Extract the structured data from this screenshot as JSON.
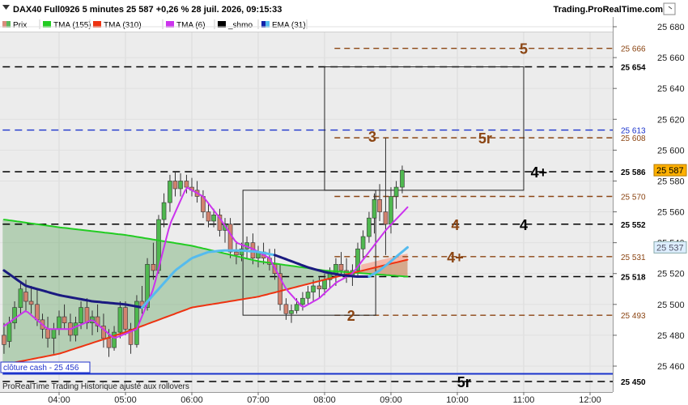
{
  "header": {
    "title": "DAX40 Full0926 5 minutes 25 587 +0,26 % 28 juil. 2026, 09:15:33",
    "site": "Trading.ProRealTime.com"
  },
  "legend": [
    {
      "label": "Prix",
      "color": "#d98c7a",
      "color2": "#5bb85b"
    },
    {
      "label": "TMA (155)",
      "color": "#22cc22"
    },
    {
      "label": "TMA (310)",
      "color": "#ee3311"
    },
    {
      "label": "TMA (6)",
      "color": "#cc33ee"
    },
    {
      "label": "_shmo",
      "color": "#000000"
    },
    {
      "label": "EMA (31)",
      "color": "#1122aa",
      "color2": "#55bbee"
    }
  ],
  "footer": {
    "cloture_label": "clôture cash -  25 456",
    "note": "ProRealTime Trading  Historique ajusté aux rollovers"
  },
  "chart_data": {
    "type": "candlestick",
    "ylim": [
      25445,
      25680
    ],
    "y_ticks": [
      "25 460",
      "25 480",
      "25 500",
      "25 520",
      "25 540",
      "25 560",
      "25 580",
      "25 600",
      "25 620",
      "25 640",
      "25 660",
      "25 680"
    ],
    "x_ticks": [
      "04:00",
      "05:00",
      "06:00",
      "07:00",
      "08:00",
      "09:00",
      "10:00",
      "11:00",
      "12:00"
    ],
    "x_tick_hours": [
      4,
      5,
      6,
      7,
      8,
      9,
      10,
      11,
      12
    ],
    "x_range_hours": [
      3.15,
      12.5
    ],
    "last_price": {
      "label": "25 587",
      "value": 25587
    },
    "ema_price": {
      "label": "25 537",
      "value": 25537
    },
    "candles": [
      [
        3.17,
        25480,
        25488,
        25468,
        25474
      ],
      [
        3.25,
        25476,
        25492,
        25472,
        25488
      ],
      [
        3.33,
        25488,
        25502,
        25484,
        25498
      ],
      [
        3.42,
        25498,
        25514,
        25494,
        25510
      ],
      [
        3.5,
        25508,
        25516,
        25496,
        25502
      ],
      [
        3.58,
        25502,
        25512,
        25494,
        25500
      ],
      [
        3.67,
        25500,
        25510,
        25486,
        25490
      ],
      [
        3.75,
        25490,
        25494,
        25478,
        25484
      ],
      [
        3.83,
        25484,
        25492,
        25472,
        25478
      ],
      [
        3.92,
        25478,
        25488,
        25468,
        25484
      ],
      [
        4.0,
        25484,
        25496,
        25480,
        25492
      ],
      [
        4.08,
        25492,
        25500,
        25484,
        25488
      ],
      [
        4.17,
        25488,
        25494,
        25476,
        25480
      ],
      [
        4.25,
        25480,
        25492,
        25476,
        25488
      ],
      [
        4.33,
        25488,
        25502,
        25484,
        25498
      ],
      [
        4.42,
        25498,
        25504,
        25484,
        25488
      ],
      [
        4.5,
        25488,
        25496,
        25480,
        25492
      ],
      [
        4.58,
        25492,
        25500,
        25482,
        25486
      ],
      [
        4.67,
        25486,
        25494,
        25472,
        25478
      ],
      [
        4.75,
        25478,
        25484,
        25466,
        25472
      ],
      [
        4.83,
        25472,
        25486,
        25470,
        25482
      ],
      [
        4.92,
        25482,
        25502,
        25478,
        25498
      ],
      [
        5.0,
        25498,
        25502,
        25480,
        25484
      ],
      [
        5.08,
        25484,
        25488,
        25468,
        25474
      ],
      [
        5.17,
        25474,
        25506,
        25472,
        25502
      ],
      [
        5.25,
        25502,
        25512,
        25494,
        25498
      ],
      [
        5.33,
        25498,
        25530,
        25496,
        25526
      ],
      [
        5.42,
        25526,
        25540,
        25516,
        25522
      ],
      [
        5.5,
        25522,
        25558,
        25520,
        25555
      ],
      [
        5.58,
        25555,
        25572,
        25550,
        25566
      ],
      [
        5.67,
        25566,
        25584,
        25560,
        25580
      ],
      [
        5.75,
        25580,
        25586,
        25570,
        25575
      ],
      [
        5.83,
        25575,
        25585,
        25570,
        25580
      ],
      [
        5.92,
        25580,
        25584,
        25572,
        25576
      ],
      [
        6.0,
        25576,
        25582,
        25570,
        25574
      ],
      [
        6.08,
        25574,
        25580,
        25566,
        25570
      ],
      [
        6.17,
        25570,
        25574,
        25556,
        25560
      ],
      [
        6.25,
        25560,
        25566,
        25550,
        25554
      ],
      [
        6.33,
        25554,
        25562,
        25550,
        25558
      ],
      [
        6.42,
        25558,
        25562,
        25544,
        25548
      ],
      [
        6.5,
        25548,
        25556,
        25540,
        25552
      ],
      [
        6.58,
        25552,
        25556,
        25530,
        25534
      ],
      [
        6.67,
        25534,
        25540,
        25526,
        25532
      ],
      [
        6.75,
        25532,
        25540,
        25528,
        25536
      ],
      [
        6.83,
        25536,
        25544,
        25530,
        25540
      ],
      [
        6.92,
        25540,
        25546,
        25526,
        25530
      ],
      [
        7.0,
        25530,
        25538,
        25524,
        25534
      ],
      [
        7.08,
        25534,
        25540,
        25526,
        25530
      ],
      [
        7.17,
        25530,
        25536,
        25522,
        25526
      ],
      [
        7.25,
        25526,
        25536,
        25516,
        25520
      ],
      [
        7.33,
        25520,
        25526,
        25496,
        25500
      ],
      [
        7.42,
        25500,
        25504,
        25490,
        25494
      ],
      [
        7.5,
        25494,
        25500,
        25488,
        25496
      ],
      [
        7.58,
        25496,
        25504,
        25494,
        25500
      ],
      [
        7.67,
        25500,
        25508,
        25496,
        25504
      ],
      [
        7.75,
        25504,
        25512,
        25500,
        25508
      ],
      [
        7.83,
        25508,
        25516,
        25502,
        25512
      ],
      [
        7.92,
        25512,
        25518,
        25504,
        25510
      ],
      [
        8.0,
        25510,
        25520,
        25506,
        25516
      ],
      [
        8.08,
        25516,
        25524,
        25510,
        25520
      ],
      [
        8.17,
        25520,
        25530,
        25512,
        25526
      ],
      [
        8.25,
        25526,
        25534,
        25518,
        25522
      ],
      [
        8.33,
        25522,
        25530,
        25514,
        25518
      ],
      [
        8.42,
        25518,
        25526,
        25512,
        25522
      ],
      [
        8.5,
        25522,
        25540,
        25518,
        25536
      ],
      [
        8.58,
        25536,
        25548,
        25530,
        25544
      ],
      [
        8.67,
        25544,
        25560,
        25540,
        25556
      ],
      [
        8.75,
        25556,
        25572,
        25546,
        25568
      ],
      [
        8.83,
        25568,
        25578,
        25554,
        25560
      ],
      [
        8.92,
        25560,
        25608,
        25532,
        25552
      ],
      [
        9.0,
        25552,
        25576,
        25546,
        25570
      ],
      [
        9.08,
        25570,
        25580,
        25562,
        25576
      ],
      [
        9.17,
        25576,
        25590,
        25572,
        25587
      ]
    ],
    "series": [
      {
        "key": "tma155",
        "color": "#22cc22",
        "width": 2,
        "points": [
          [
            3.17,
            25555
          ],
          [
            4.0,
            25550
          ],
          [
            5.0,
            25545
          ],
          [
            6.0,
            25538
          ],
          [
            7.0,
            25528
          ],
          [
            8.0,
            25522
          ],
          [
            9.25,
            25518
          ]
        ]
      },
      {
        "key": "tma310",
        "color": "#ee3311",
        "width": 2,
        "points": [
          [
            3.17,
            25461
          ],
          [
            4.0,
            25468
          ],
          [
            5.0,
            25482
          ],
          [
            6.0,
            25498
          ],
          [
            7.0,
            25505
          ],
          [
            8.0,
            25516
          ],
          [
            9.25,
            25529
          ]
        ]
      },
      {
        "key": "tma6",
        "color": "#cc33ee",
        "width": 2,
        "points": [
          [
            3.17,
            25486
          ],
          [
            3.5,
            25496
          ],
          [
            3.83,
            25484
          ],
          [
            4.17,
            25484
          ],
          [
            4.5,
            25490
          ],
          [
            4.83,
            25478
          ],
          [
            5.17,
            25484
          ],
          [
            5.42,
            25510
          ],
          [
            5.67,
            25552
          ],
          [
            5.92,
            25576
          ],
          [
            6.17,
            25570
          ],
          [
            6.42,
            25556
          ],
          [
            6.67,
            25540
          ],
          [
            6.92,
            25536
          ],
          [
            7.17,
            25530
          ],
          [
            7.42,
            25510
          ],
          [
            7.67,
            25498
          ],
          [
            7.92,
            25504
          ],
          [
            8.17,
            25514
          ],
          [
            8.42,
            25520
          ],
          [
            8.67,
            25534
          ],
          [
            8.92,
            25548
          ],
          [
            9.25,
            25563
          ]
        ]
      },
      {
        "key": "ema31_dark",
        "color": "#1a1a80",
        "width": 3,
        "points": [
          [
            3.17,
            25522
          ],
          [
            3.5,
            25512
          ],
          [
            4.0,
            25506
          ],
          [
            4.5,
            25502
          ],
          [
            5.0,
            25500
          ],
          [
            5.25,
            25498
          ]
        ]
      },
      {
        "key": "ema31_light",
        "color": "#55bbee",
        "width": 3,
        "points": [
          [
            5.25,
            25498
          ],
          [
            5.5,
            25510
          ],
          [
            5.75,
            25522
          ],
          [
            6.0,
            25530
          ],
          [
            6.25,
            25534
          ],
          [
            6.5,
            25535
          ],
          [
            6.75,
            25535
          ],
          [
            7.0,
            25534
          ],
          [
            7.25,
            25532
          ]
        ]
      },
      {
        "key": "ema31_dark2",
        "color": "#1a1a80",
        "width": 3,
        "points": [
          [
            7.25,
            25532
          ],
          [
            7.5,
            25528
          ],
          [
            7.75,
            25524
          ],
          [
            8.0,
            25521
          ],
          [
            8.25,
            25519
          ],
          [
            8.5,
            25518
          ],
          [
            8.67,
            25518
          ]
        ]
      },
      {
        "key": "ema31_light2",
        "color": "#55bbee",
        "width": 3,
        "points": [
          [
            8.67,
            25518
          ],
          [
            8.83,
            25522
          ],
          [
            9.0,
            25528
          ],
          [
            9.25,
            25537
          ]
        ]
      }
    ],
    "levels": [
      {
        "value": 25666,
        "label": "25 666",
        "style": "brown",
        "x_from": 8.15
      },
      {
        "value": 25654,
        "label": "25 654",
        "style": "black",
        "x_from": 3.15
      },
      {
        "value": 25613,
        "label": "25 613",
        "style": "blue",
        "x_from": 3.15
      },
      {
        "value": 25608,
        "label": "25 608",
        "style": "brown",
        "x_from": 8.15
      },
      {
        "value": 25586,
        "label": "25 586",
        "style": "black",
        "x_from": 3.15
      },
      {
        "value": 25570,
        "label": "25 570",
        "style": "brown",
        "x_from": 8.15
      },
      {
        "value": 25552,
        "label": "25 552",
        "style": "black",
        "x_from": 3.15
      },
      {
        "value": 25531,
        "label": "25 531",
        "style": "brown",
        "x_from": 8.15
      },
      {
        "value": 25518,
        "label": "25 518",
        "style": "black",
        "x_from": 3.15
      },
      {
        "value": 25493,
        "label": "25 493",
        "style": "brown",
        "x_from": 8.15
      },
      {
        "value": 25450,
        "label": "25 450",
        "style": "black",
        "x_from": 3.15
      },
      {
        "value": 25455,
        "label": "",
        "style": "solidblue",
        "x_from": 3.15
      }
    ],
    "boxes": [
      {
        "x1": 6.77,
        "x2": 8.77,
        "y1": 25574,
        "y2": 25493
      },
      {
        "x1": 8.0,
        "x2": 11.0,
        "y1": 25654,
        "y2": 25574
      }
    ],
    "annotations": [
      {
        "text": "5",
        "x": 11.0,
        "y": 25666,
        "color": "#8b4513"
      },
      {
        "text": "3",
        "x": 8.72,
        "y": 25609,
        "color": "#8b4513"
      },
      {
        "text": "5r",
        "x": 10.42,
        "y": 25608,
        "color": "#8b4513"
      },
      {
        "text": "4+",
        "x": 11.23,
        "y": 25586,
        "color": "#000000"
      },
      {
        "text": "4",
        "x": 9.97,
        "y": 25552,
        "color": "#8b4513"
      },
      {
        "text": "4",
        "x": 11.0,
        "y": 25552,
        "color": "#000000"
      },
      {
        "text": "4+",
        "x": 9.97,
        "y": 25531,
        "color": "#8b4513"
      },
      {
        "text": "2",
        "x": 8.4,
        "y": 25493,
        "color": "#8b4513"
      },
      {
        "text": "5r",
        "x": 10.1,
        "y": 25450,
        "color": "#000000"
      }
    ]
  }
}
